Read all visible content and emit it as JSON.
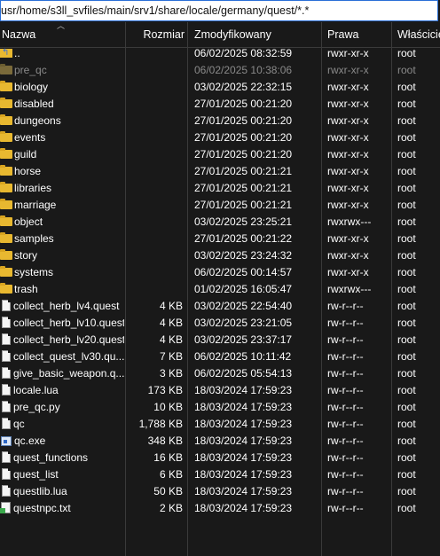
{
  "path": "usr/home/s3ll_svfiles/main/srv1/share/locale/germany/quest/*.*",
  "columns": {
    "name": "Nazwa",
    "size": "Rozmiar",
    "modified": "Zmodyfikowany",
    "perms": "Prawa",
    "owner": "Właściciel"
  },
  "rows": [
    {
      "name": "..",
      "size": "",
      "date": "06/02/2025 08:32:59",
      "perm": "rwxr-xr-x",
      "owner": "root",
      "icon": "up-folder-icon"
    },
    {
      "name": "pre_qc",
      "size": "",
      "date": "06/02/2025 10:38:06",
      "perm": "rwxr-xr-x",
      "owner": "root",
      "icon": "folder-icon",
      "dim": true
    },
    {
      "name": "biology",
      "size": "",
      "date": "03/02/2025 22:32:15",
      "perm": "rwxr-xr-x",
      "owner": "root",
      "icon": "folder-icon"
    },
    {
      "name": "disabled",
      "size": "",
      "date": "27/01/2025 00:21:20",
      "perm": "rwxr-xr-x",
      "owner": "root",
      "icon": "folder-icon"
    },
    {
      "name": "dungeons",
      "size": "",
      "date": "27/01/2025 00:21:20",
      "perm": "rwxr-xr-x",
      "owner": "root",
      "icon": "folder-icon"
    },
    {
      "name": "events",
      "size": "",
      "date": "27/01/2025 00:21:20",
      "perm": "rwxr-xr-x",
      "owner": "root",
      "icon": "folder-icon"
    },
    {
      "name": "guild",
      "size": "",
      "date": "27/01/2025 00:21:20",
      "perm": "rwxr-xr-x",
      "owner": "root",
      "icon": "folder-icon"
    },
    {
      "name": "horse",
      "size": "",
      "date": "27/01/2025 00:21:21",
      "perm": "rwxr-xr-x",
      "owner": "root",
      "icon": "folder-icon"
    },
    {
      "name": "libraries",
      "size": "",
      "date": "27/01/2025 00:21:21",
      "perm": "rwxr-xr-x",
      "owner": "root",
      "icon": "folder-icon"
    },
    {
      "name": "marriage",
      "size": "",
      "date": "27/01/2025 00:21:21",
      "perm": "rwxr-xr-x",
      "owner": "root",
      "icon": "folder-icon"
    },
    {
      "name": "object",
      "size": "",
      "date": "03/02/2025 23:25:21",
      "perm": "rwxrwx---",
      "owner": "root",
      "icon": "folder-icon"
    },
    {
      "name": "samples",
      "size": "",
      "date": "27/01/2025 00:21:22",
      "perm": "rwxr-xr-x",
      "owner": "root",
      "icon": "folder-icon"
    },
    {
      "name": "story",
      "size": "",
      "date": "03/02/2025 23:24:32",
      "perm": "rwxr-xr-x",
      "owner": "root",
      "icon": "folder-icon"
    },
    {
      "name": "systems",
      "size": "",
      "date": "06/02/2025 00:14:57",
      "perm": "rwxr-xr-x",
      "owner": "root",
      "icon": "folder-icon"
    },
    {
      "name": "trash",
      "size": "",
      "date": "01/02/2025 16:05:47",
      "perm": "rwxrwx---",
      "owner": "root",
      "icon": "folder-icon"
    },
    {
      "name": "collect_herb_lv4.quest",
      "size": "4 KB",
      "date": "03/02/2025 22:54:40",
      "perm": "rw-r--r--",
      "owner": "root",
      "icon": "file-icon"
    },
    {
      "name": "collect_herb_lv10.quest",
      "size": "4 KB",
      "date": "03/02/2025 23:21:05",
      "perm": "rw-r--r--",
      "owner": "root",
      "icon": "file-icon"
    },
    {
      "name": "collect_herb_lv20.quest",
      "size": "4 KB",
      "date": "03/02/2025 23:37:17",
      "perm": "rw-r--r--",
      "owner": "root",
      "icon": "file-icon"
    },
    {
      "name": "collect_quest_lv30.qu...",
      "size": "7 KB",
      "date": "06/02/2025 10:11:42",
      "perm": "rw-r--r--",
      "owner": "root",
      "icon": "file-icon"
    },
    {
      "name": "give_basic_weapon.q...",
      "size": "3 KB",
      "date": "06/02/2025 05:54:13",
      "perm": "rw-r--r--",
      "owner": "root",
      "icon": "file-icon"
    },
    {
      "name": "locale.lua",
      "size": "173 KB",
      "date": "18/03/2024 17:59:23",
      "perm": "rw-r--r--",
      "owner": "root",
      "icon": "file-icon"
    },
    {
      "name": "pre_qc.py",
      "size": "10 KB",
      "date": "18/03/2024 17:59:23",
      "perm": "rw-r--r--",
      "owner": "root",
      "icon": "file-icon"
    },
    {
      "name": "qc",
      "size": "1,788 KB",
      "date": "18/03/2024 17:59:23",
      "perm": "rw-r--r--",
      "owner": "root",
      "icon": "file-icon"
    },
    {
      "name": "qc.exe",
      "size": "348 KB",
      "date": "18/03/2024 17:59:23",
      "perm": "rw-r--r--",
      "owner": "root",
      "icon": "exe-icon"
    },
    {
      "name": "quest_functions",
      "size": "16 KB",
      "date": "18/03/2024 17:59:23",
      "perm": "rw-r--r--",
      "owner": "root",
      "icon": "file-icon"
    },
    {
      "name": "quest_list",
      "size": "6 KB",
      "date": "18/03/2024 17:59:23",
      "perm": "rw-r--r--",
      "owner": "root",
      "icon": "file-icon"
    },
    {
      "name": "questlib.lua",
      "size": "50 KB",
      "date": "18/03/2024 17:59:23",
      "perm": "rw-r--r--",
      "owner": "root",
      "icon": "file-icon"
    },
    {
      "name": "questnpc.txt",
      "size": "2 KB",
      "date": "18/03/2024 17:59:23",
      "perm": "rw-r--r--",
      "owner": "root",
      "icon": "txt-file-icon"
    }
  ]
}
